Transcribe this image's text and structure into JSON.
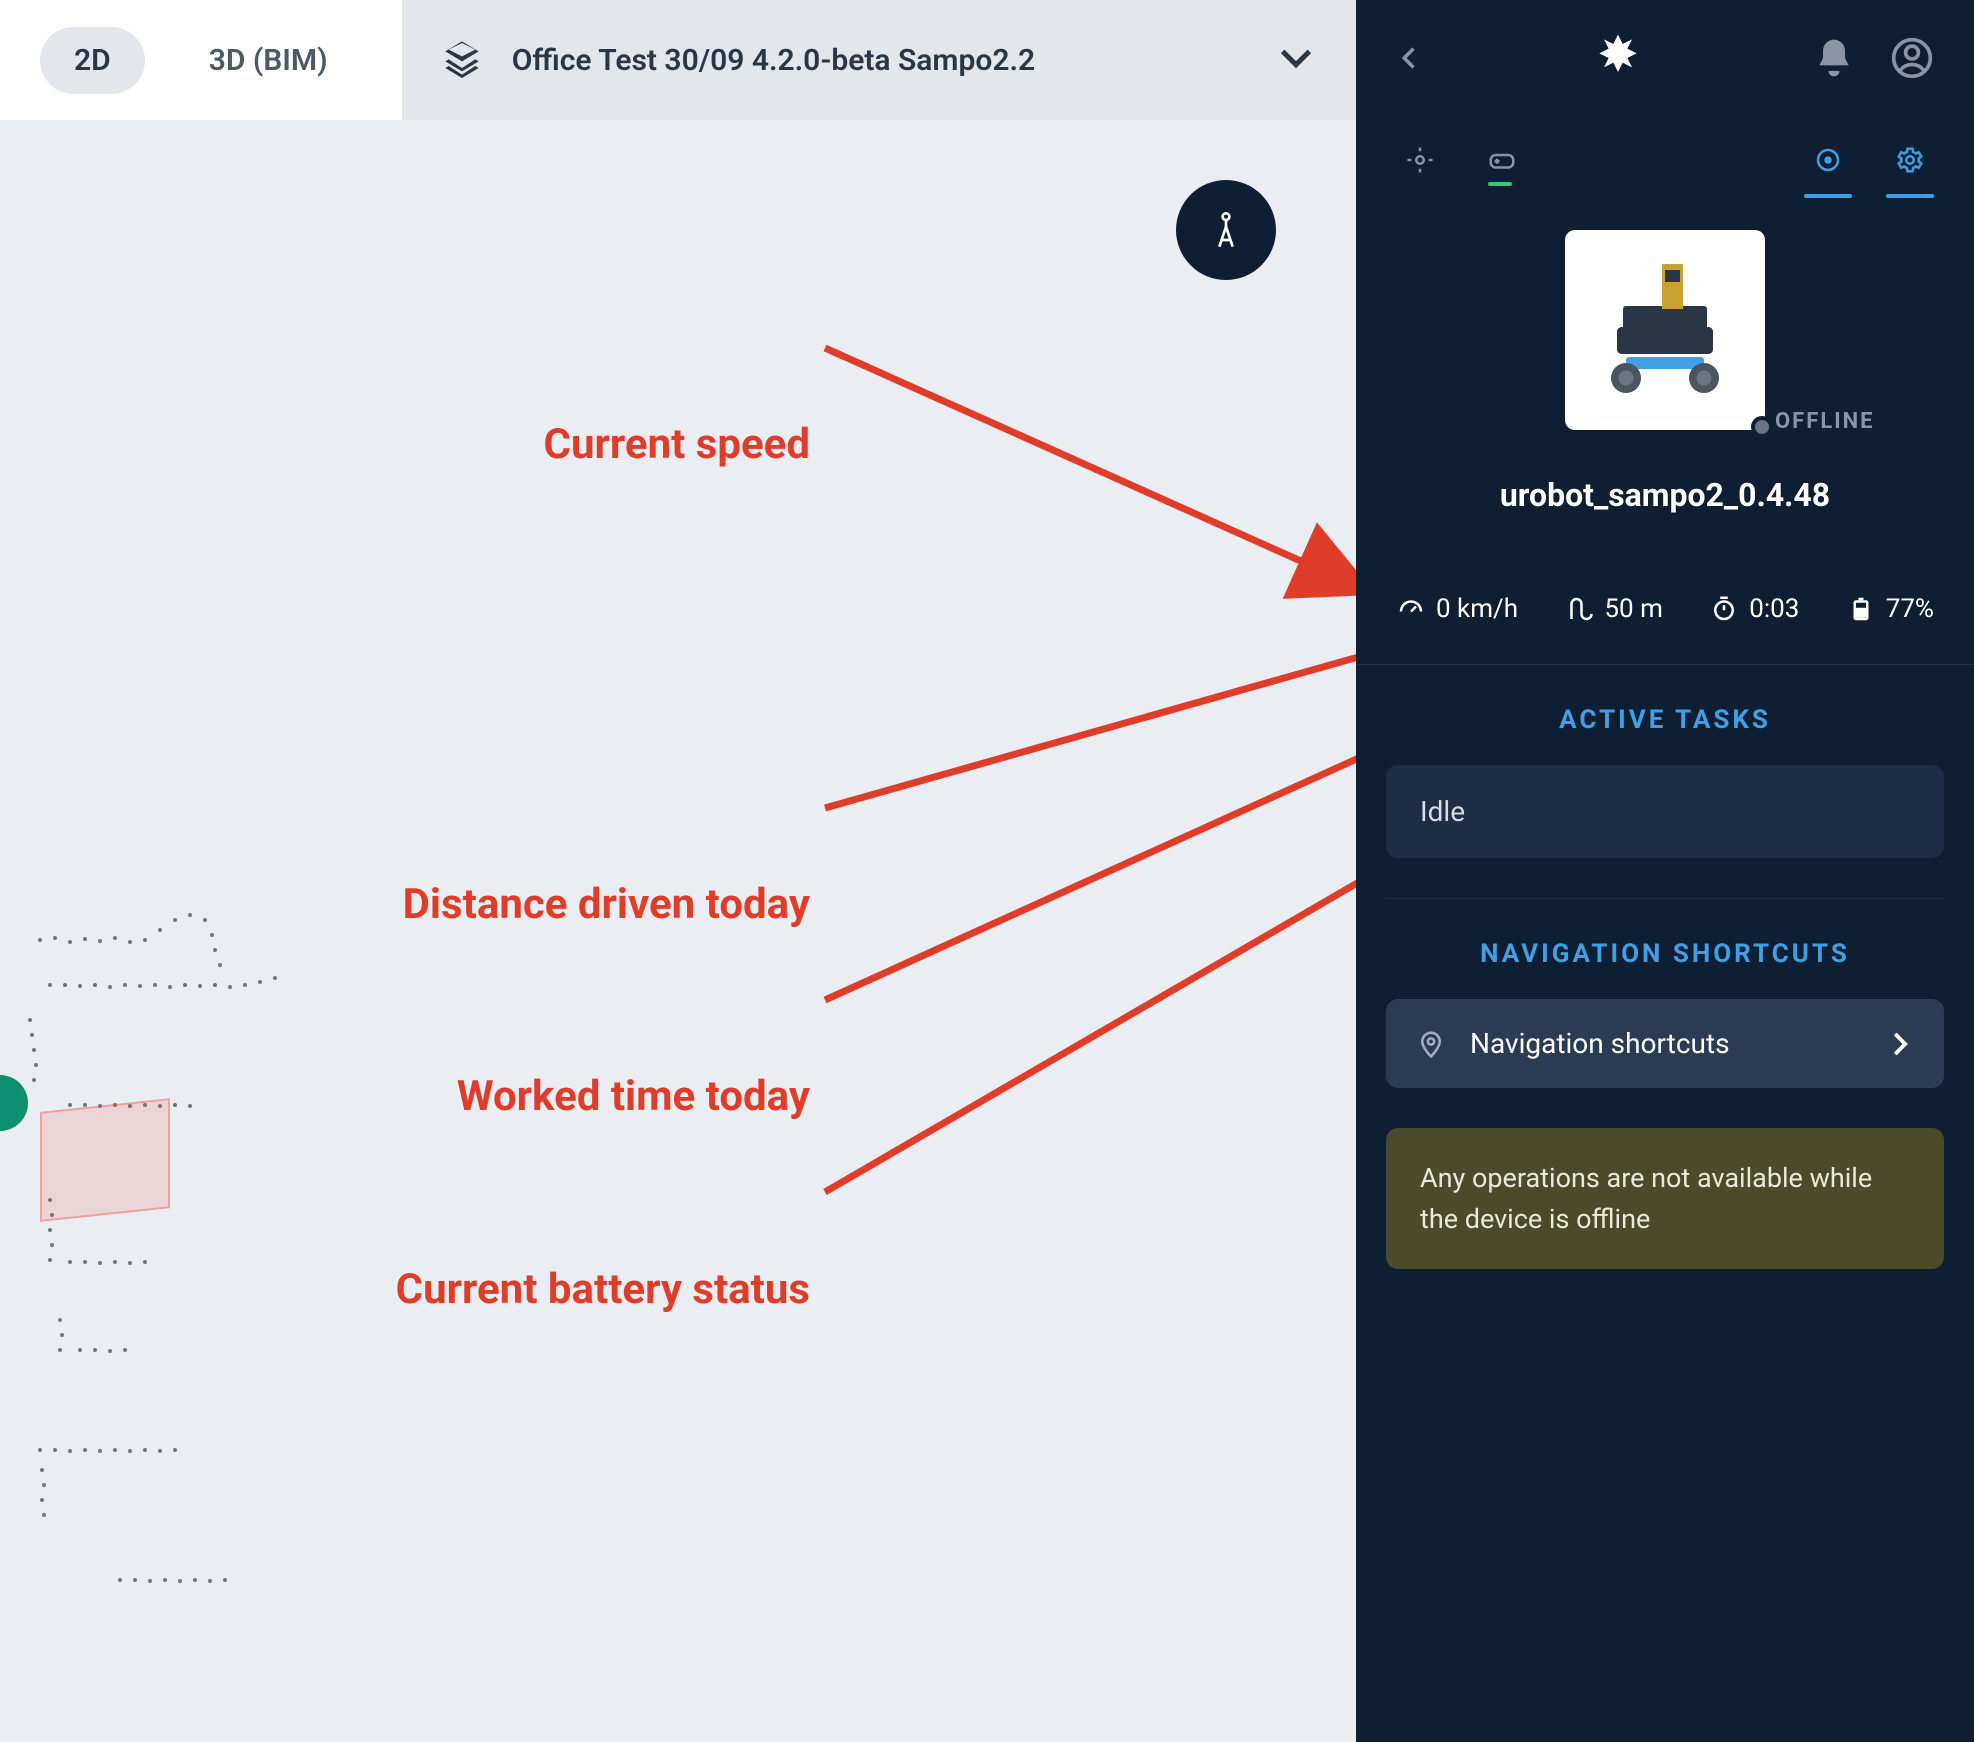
{
  "map_bar": {
    "tabs": {
      "two_d": "2D",
      "three_d": "3D (BIM)"
    },
    "map_name": "Office Test 30/09 4.2.0-beta Sampo2.2"
  },
  "annotations": {
    "speed": "Current speed",
    "distance": "Distance driven today",
    "time": "Worked  time today",
    "battery": "Current battery status"
  },
  "sidebar": {
    "status_label": "OFFLINE",
    "robot_name": "urobot_sampo2_0.4.48",
    "stats": {
      "speed": "0 km/h",
      "distance": "50 m",
      "time": "0:03",
      "battery": "77%"
    },
    "active_tasks_header": "ACTIVE TASKS",
    "active_task_state": "Idle",
    "nav_header": "NAVIGATION SHORTCUTS",
    "nav_shortcut_label": "Navigation shortcuts",
    "warning": "Any operations are not available while the device is offline"
  }
}
